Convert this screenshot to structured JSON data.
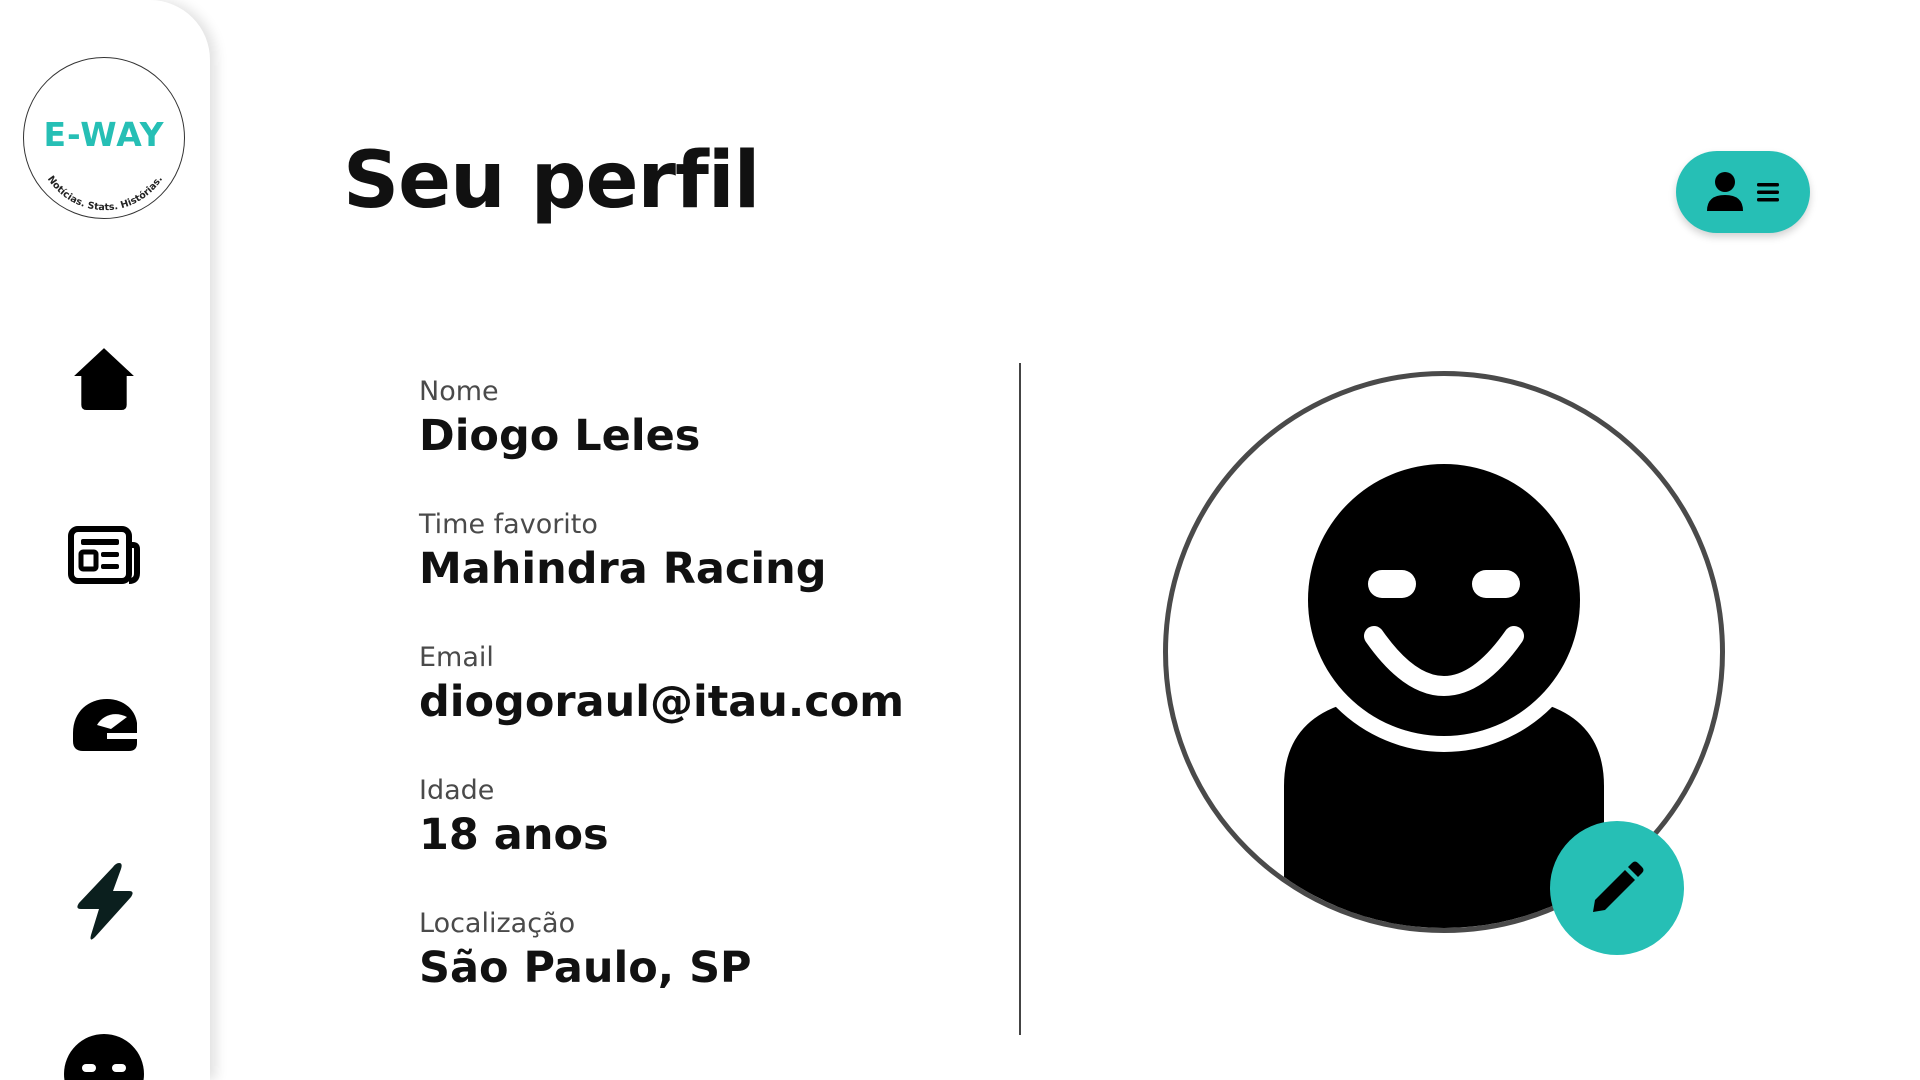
{
  "brand": {
    "logo_text": "E-WAY",
    "tagline": "Notícias. Stats. Histórias.",
    "accent_color": "#26bfb5"
  },
  "sidebar": {
    "items": [
      {
        "icon": "home-icon"
      },
      {
        "icon": "newspaper-icon"
      },
      {
        "icon": "helmet-icon"
      },
      {
        "icon": "lightning-icon"
      },
      {
        "icon": "profile-face-icon"
      }
    ]
  },
  "header": {
    "title": "Seu perfil",
    "menu_icons": [
      "user-icon",
      "menu-icon"
    ]
  },
  "profile": {
    "fields": [
      {
        "label": "Nome",
        "value": "Diogo Leles"
      },
      {
        "label": "Time favorito",
        "value": "Mahindra Racing"
      },
      {
        "label": "Email",
        "value": "diogoraul@itau.com"
      },
      {
        "label": "Idade",
        "value": "18 anos"
      },
      {
        "label": "Localização",
        "value": "São Paulo, SP"
      }
    ],
    "avatar_icon": "smiley-person-icon",
    "edit_icon": "pencil-icon"
  }
}
